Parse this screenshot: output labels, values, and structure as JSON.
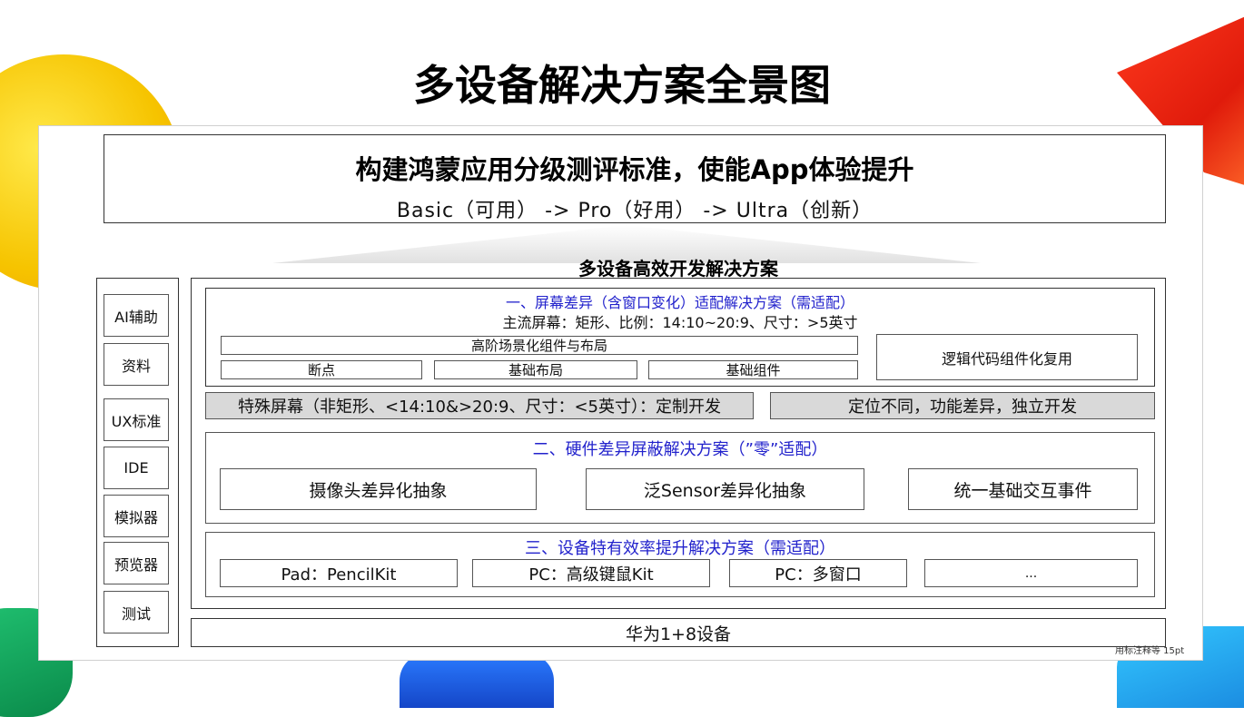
{
  "slide": {
    "title": "多设备解决方案全景图",
    "footnote": "用标注释等 15pt"
  },
  "standard": {
    "headline": "构建鸿蒙应用分级测评标准，使能App体验提升",
    "levels": "Basic（可用） -> Pro（好用） -> Ultra（创新）"
  },
  "solution_title": "多设备高效开发解决方案",
  "sidebar": {
    "items": [
      "AI辅助",
      "资料",
      "UX标准",
      "IDE",
      "模拟器",
      "预览器",
      "测试"
    ]
  },
  "section1": {
    "title": "一、屏幕差异（含窗口变化）适配解决方案（需适配）",
    "subtitle": "主流屏幕：矩形、比例：14:10~20:9、尺寸：>5英寸",
    "advanced": "高阶场景化组件与布局",
    "breakpoint": "断点",
    "basic_layout": "基础布局",
    "basic_components": "基础组件",
    "logic_reuse": "逻辑代码组件化复用"
  },
  "special": {
    "screens": "特殊屏幕（非矩形、<14:10&>20:9、尺寸：<5英寸）：定制开发",
    "positioning": "定位不同，功能差异，独立开发"
  },
  "section2": {
    "title": "二、硬件差异屏蔽解决方案（”零”适配）",
    "items": [
      "摄像头差异化抽象",
      "泛Sensor差异化抽象",
      "统一基础交互事件"
    ]
  },
  "section3": {
    "title": "三、设备特有效率提升解决方案（需适配）",
    "items": [
      "Pad：PencilKit",
      "PC：高级键鼠Kit",
      "PC：多窗口",
      "..."
    ]
  },
  "devices": "华为1+8设备",
  "colors": {
    "section_title_blue": "#2222cc",
    "grey_fill": "#d9d9d9",
    "border": "#333333"
  }
}
